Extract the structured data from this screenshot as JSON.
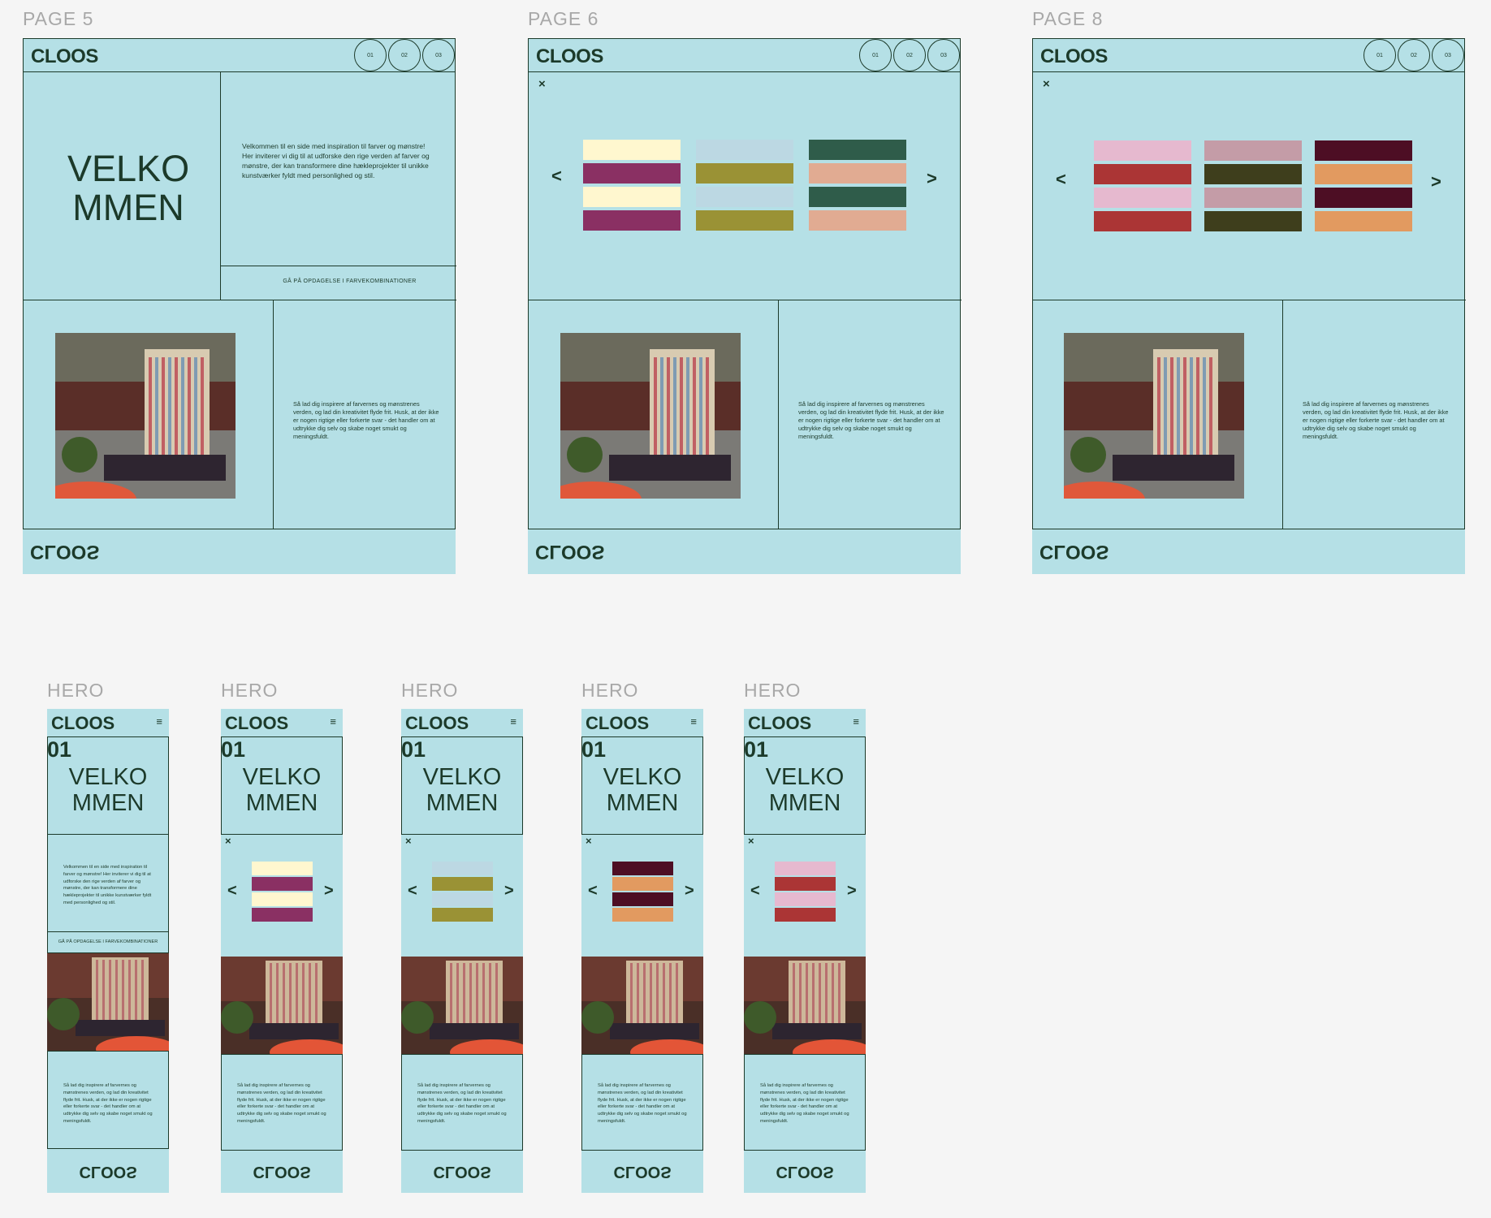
{
  "labels": {
    "page5": "PAGE 5",
    "page6": "PAGE 6",
    "page8": "PAGE 8",
    "hero": "HERO"
  },
  "brand": {
    "logo": "CLOOS",
    "footer_logo": "CLOOS"
  },
  "nav": {
    "n1": "01",
    "n2": "02",
    "n3": "03"
  },
  "content": {
    "welcome_line1": "VELKO",
    "welcome_line2": "MMEN",
    "intro": "Velkommen til en side med inspiration til farver og mønstre! Her inviterer vi dig til at udforske den rige verden af farver og mønstre, der kan transformere dine hækleprojekter til unikke kunstværker fyldt med personlighed og stil.",
    "cta": "GÅ PÅ OPDAGELSE I FARVEKOMBINATIONER",
    "body": "Så lad dig inspirere af farvernes og mønstrenes verden, og lad din kreativitet flyde frit. Husk, at der ikke er nogen rigtige eller forkerte svar - det handler om at udtrykke dig selv og skabe noget smukt og meningsfuldt.",
    "close": "×",
    "prev": "<",
    "next": ">",
    "menu": "≡",
    "number": "01"
  },
  "colors": {
    "background": "#b5e0e6",
    "ink": "#1c3a2a",
    "palette_p6": [
      [
        "#fff7cf",
        "#8a3063",
        "#fff7cf",
        "#8a3063"
      ],
      [
        "#bcd8e3",
        "#9a9235",
        "#bcd8e3",
        "#9a9235"
      ],
      [
        "#2f5c4a",
        "#e1ab92",
        "#2f5c4a",
        "#e1ab92"
      ]
    ],
    "palette_p8": [
      [
        "#e6b9cf",
        "#ab3535",
        "#e6b9cf",
        "#ab3535"
      ],
      [
        "#c49ca7",
        "#3e3e1c",
        "#c49ca7",
        "#3e3e1c"
      ],
      [
        "#4d0e24",
        "#e29a60",
        "#4d0e24",
        "#e29a60"
      ]
    ]
  },
  "icons": {
    "close": "close-icon",
    "prev": "chevron-left-icon",
    "next": "chevron-right-icon",
    "menu": "hamburger-menu-icon"
  }
}
